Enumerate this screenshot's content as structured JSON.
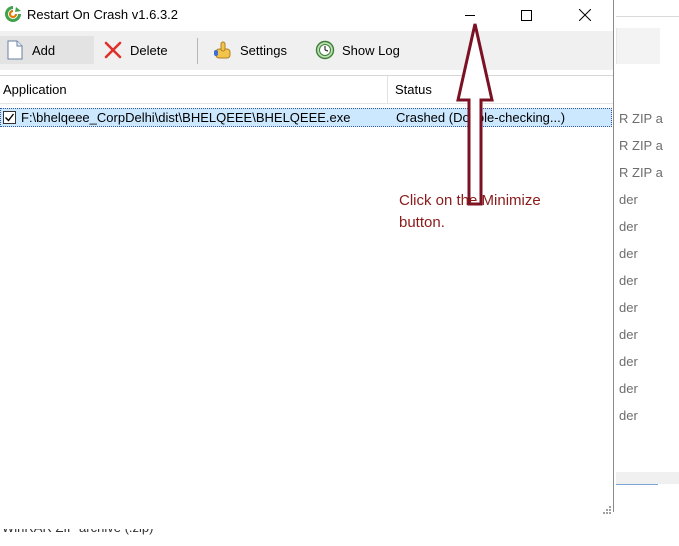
{
  "window": {
    "title": "Restart On Crash v1.6.3.2",
    "caption_buttons": [
      "minimize-icon",
      "maximize-icon",
      "close-icon"
    ]
  },
  "toolbar": {
    "add_label": "Add",
    "delete_label": "Delete",
    "settings_label": "Settings",
    "show_log_label": "Show Log"
  },
  "list": {
    "columns": [
      "Application",
      "Status"
    ],
    "rows": [
      {
        "checked": true,
        "application": "F:\\bhelqeee_CorpDelhi\\dist\\BHELQEEE\\BHELQEEE.exe",
        "status": "Crashed (Double-checking...)"
      }
    ]
  },
  "annotation": {
    "text": "Click on the Minimize\nbutton.",
    "color": "#8b1a1a"
  },
  "background_window": {
    "rows": [
      "R ZIP a",
      "R ZIP a",
      "R ZIP a",
      "der",
      "der",
      "der",
      "der",
      "der",
      "der",
      "der",
      "der",
      "der"
    ],
    "bottom_text": "WinRAR ZIP archive (.zip)"
  }
}
